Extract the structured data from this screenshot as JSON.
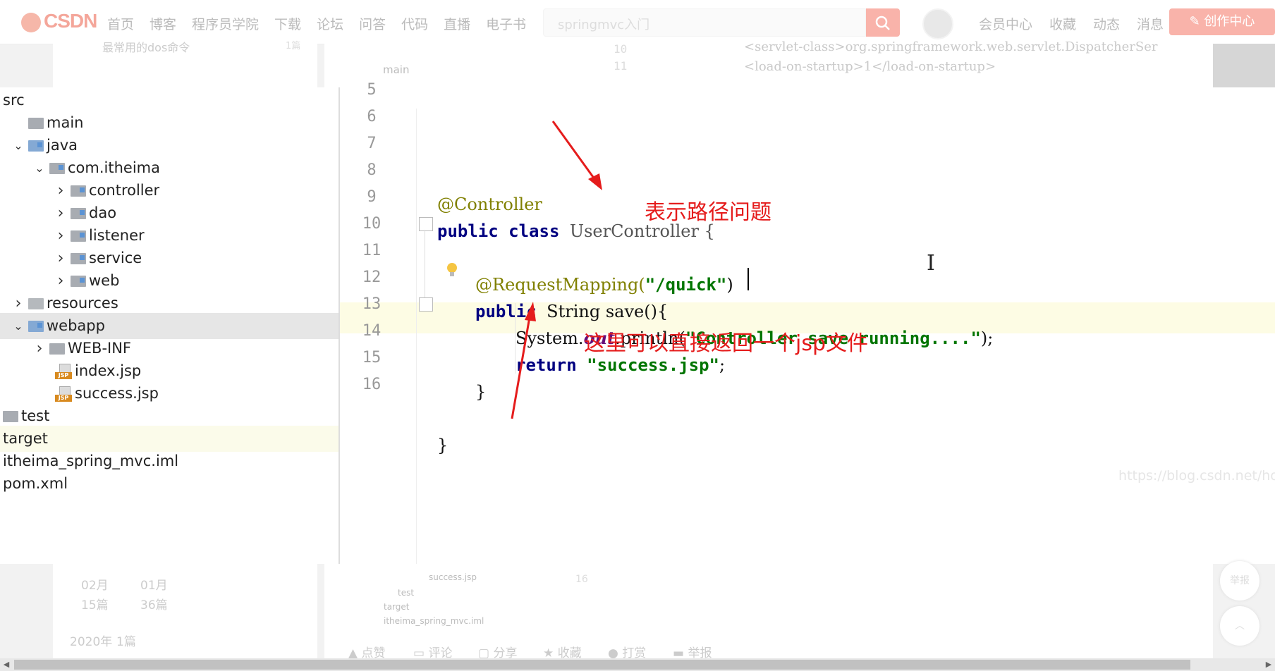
{
  "site": {
    "logo": "CSDN",
    "nav": [
      "首页",
      "博客",
      "程序员学院",
      "下载",
      "论坛",
      "问答",
      "代码",
      "直播",
      "电子书"
    ],
    "search_placeholder": "springmvc入门",
    "right_nav": [
      "会员中心",
      "收藏",
      "动态",
      "消息"
    ],
    "create_button": "创作中心"
  },
  "background": {
    "left_snippet": "最常用的dos命令",
    "left_count": "1篇",
    "center_main": "main",
    "center_line_numbers": [
      "10",
      "11"
    ],
    "center_code": [
      "<servlet-class>org.springframework.web.servlet.DispatcherSer",
      "<load-on-startup>1</load-on-startup>"
    ],
    "bottom_stats": {
      "m1": "02月",
      "m2": "01月",
      "c1": "15篇",
      "c2": "36篇",
      "year": "2020年",
      "year_count": "1篇"
    },
    "bottom_tree": [
      "success.jsp",
      "test",
      "target",
      "itheima_spring_mvc.iml"
    ],
    "bottom_line": "16",
    "actions": [
      "点赞",
      "评论",
      "分享",
      "收藏",
      "打赏",
      "举报"
    ],
    "side_report": "举报"
  },
  "tree": [
    {
      "label": "src",
      "indent": 0,
      "type": "none"
    },
    {
      "label": "main",
      "indent": 1,
      "type": "folder"
    },
    {
      "label": "java",
      "indent": 1,
      "type": "folder-blue",
      "chevron": "open"
    },
    {
      "label": "com.itheima",
      "indent": 2,
      "type": "package",
      "chevron": "open"
    },
    {
      "label": "controller",
      "indent": 3,
      "type": "package",
      "chevron": "closed"
    },
    {
      "label": "dao",
      "indent": 3,
      "type": "package",
      "chevron": "closed"
    },
    {
      "label": "listener",
      "indent": 3,
      "type": "package",
      "chevron": "closed"
    },
    {
      "label": "service",
      "indent": 3,
      "type": "package",
      "chevron": "closed"
    },
    {
      "label": "web",
      "indent": 3,
      "type": "package",
      "chevron": "closed"
    },
    {
      "label": "resources",
      "indent": 1,
      "type": "resources",
      "chevron": "closed"
    },
    {
      "label": "webapp",
      "indent": 1,
      "type": "folder-blue",
      "chevron": "open",
      "selected": true
    },
    {
      "label": "WEB-INF",
      "indent": 2,
      "type": "folder",
      "chevron": "closed"
    },
    {
      "label": "index.jsp",
      "indent": 2,
      "type": "jsp"
    },
    {
      "label": "success.jsp",
      "indent": 2,
      "type": "jsp"
    },
    {
      "label": "test",
      "indent": 0,
      "type": "folder"
    },
    {
      "label": "target",
      "indent": 0,
      "type": "none",
      "highlight": true
    },
    {
      "label": "itheima_spring_mvc.iml",
      "indent": 0,
      "type": "none"
    },
    {
      "label": "pom.xml",
      "indent": 0,
      "type": "none"
    }
  ],
  "editor": {
    "line_numbers": [
      "5",
      "6",
      "7",
      "8",
      "9",
      "10",
      "11",
      "12",
      "13",
      "14",
      "15",
      "16"
    ],
    "lines": {
      "l6_ann": "@Controller",
      "l7_kw": "public class ",
      "l7_cls": "UserController {",
      "l9_ann": "@RequestMapping(",
      "l9_str": "\"/quick\"",
      "l9_end": ")",
      "l10_kw": "public ",
      "l10_rest": "String save(){",
      "l11_pre": "System.",
      "l11_fld": "out",
      "l11_mid": ".println(",
      "l11_str": "\"Controller save running....\"",
      "l11_end": ");",
      "l12_kw": "return ",
      "l12_str": "\"success.jsp\"",
      "l12_end": ";",
      "l13": "}",
      "l15": "}"
    },
    "cursor_glyph": "I"
  },
  "annotations": {
    "path_note": "表示路径问题",
    "return_note": "这里可以直接返回一个jsp文件",
    "arrow_color": "#e51c1c"
  },
  "watermark": "https://blog.csdn.net/hou"
}
